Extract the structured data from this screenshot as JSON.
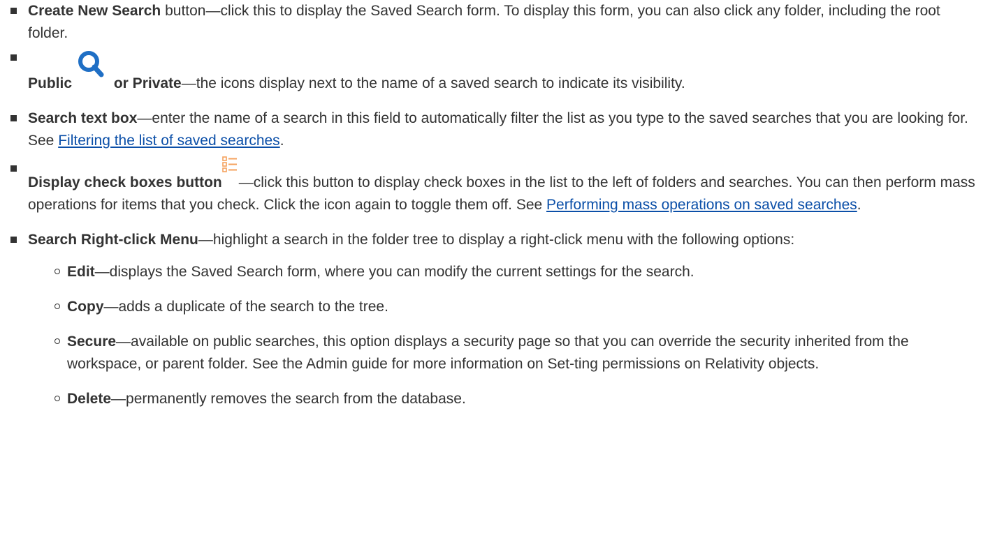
{
  "items": [
    {
      "bold": "Create New Search",
      "text": " button—click this to display the Saved Search form. To display this form, you can also click any folder, including the root folder."
    },
    {
      "bold_a": "Public",
      "icon": "magnifier-search-icon",
      "bold_b": " or Private",
      "text": "—the icons display next to the name of a saved search to indicate its visibility."
    },
    {
      "bold": "Search text box",
      "text": "—enter the name of a search in this field to automatically filter the list as you type to the saved searches that you are looking for. See ",
      "link": "Filtering the list of saved searches",
      "after": "."
    },
    {
      "bold": "Display check boxes button",
      "icon": "checklist-icon",
      "text": "—click this button to display check boxes in the list to the left of folders and searches. You can then perform mass operations for items that you check. Click the icon again to toggle them off. See ",
      "link": "Performing mass operations on saved searches",
      "after": "."
    },
    {
      "bold": "Search Right-click Menu",
      "text": "—highlight a search in the folder tree to display a right-click menu with the following options:"
    }
  ],
  "subitems": [
    {
      "bold": "Edit",
      "text": "—displays the Saved Search form, where you can modify the current settings for the search."
    },
    {
      "bold": "Copy",
      "text": "—adds a duplicate of the search to the tree."
    },
    {
      "bold": "Secure",
      "text": "—available on public searches, this option displays a security page so that you can override the security inherited from the workspace, or parent folder. See the Admin guide for more information on Set-ting permissions on Relativity objects."
    },
    {
      "bold": "Delete",
      "text": "—permanently removes the search from the database."
    }
  ],
  "colors": {
    "text": "#333333",
    "link": "#0b4fa8",
    "search_icon": "#1f6fc5",
    "list_icon": "#f5a25d"
  }
}
